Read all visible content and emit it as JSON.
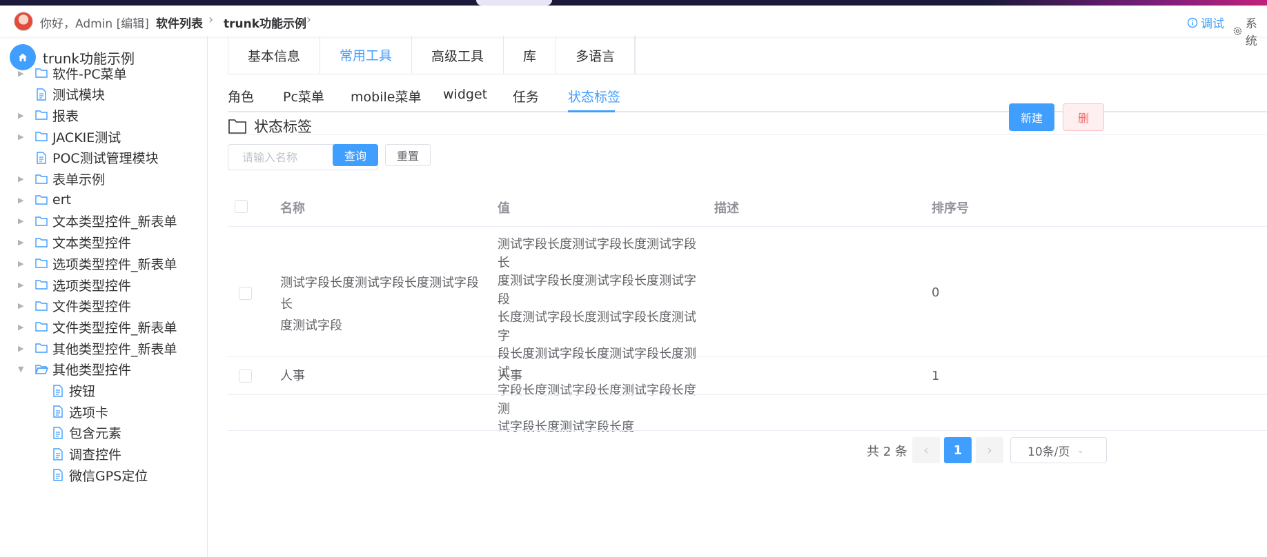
{
  "header": {
    "greeting": "你好，Admin [编辑]",
    "breadcrumb": [
      "软件列表",
      "trunk功能示例"
    ],
    "debug_label": "调试",
    "system_label": "系统"
  },
  "sidebar": {
    "root_label": "trunk功能示例",
    "items": [
      {
        "label": "软件-PC菜单",
        "type": "folder",
        "arrow": true
      },
      {
        "label": "测试模块",
        "type": "file",
        "arrow": false
      },
      {
        "label": "报表",
        "type": "folder",
        "arrow": true
      },
      {
        "label": "JACKIE测试",
        "type": "folder",
        "arrow": true
      },
      {
        "label": "POC测试管理模块",
        "type": "file",
        "arrow": false
      },
      {
        "label": "表单示例",
        "type": "folder",
        "arrow": true
      },
      {
        "label": "ert",
        "type": "folder",
        "arrow": true
      },
      {
        "label": "文本类型控件_新表单",
        "type": "folder",
        "arrow": true
      },
      {
        "label": "文本类型控件",
        "type": "folder",
        "arrow": true
      },
      {
        "label": "选项类型控件_新表单",
        "type": "folder",
        "arrow": true
      },
      {
        "label": "选项类型控件",
        "type": "folder",
        "arrow": true
      },
      {
        "label": "文件类型控件",
        "type": "folder",
        "arrow": true
      },
      {
        "label": "文件类型控件_新表单",
        "type": "folder",
        "arrow": true
      },
      {
        "label": "其他类型控件_新表单",
        "type": "folder",
        "arrow": true
      },
      {
        "label": "其他类型控件",
        "type": "folder-open",
        "arrow": true,
        "expanded": true
      },
      {
        "label": "按钮",
        "type": "file",
        "child": true
      },
      {
        "label": "选项卡",
        "type": "file",
        "child": true
      },
      {
        "label": "包含元素",
        "type": "file",
        "child": true
      },
      {
        "label": "调查控件",
        "type": "file",
        "child": true
      },
      {
        "label": "微信GPS定位",
        "type": "file",
        "child": true
      }
    ]
  },
  "tabs_primary": [
    "基本信息",
    "常用工具",
    "高级工具",
    "库",
    "多语言"
  ],
  "tabs_primary_active": 1,
  "tabs_secondary": [
    "角色",
    "Pc菜单",
    "mobile菜单",
    "widget",
    "任务",
    "状态标签"
  ],
  "tabs_secondary_active": 5,
  "section": {
    "title": "状态标签",
    "new_button": "新建",
    "delete_button": "删"
  },
  "search": {
    "placeholder": "请输入名称",
    "query_button": "查询",
    "reset_button": "重置"
  },
  "table": {
    "columns": [
      "名称",
      "值",
      "描述",
      "排序号"
    ],
    "rows": [
      {
        "name": [
          "测试字段长度测试字段长度测试字段长",
          "度测试字段"
        ],
        "value": [
          "测试字段长度测试字段长度测试字段长",
          "度测试字段长度测试字段长度测试字段",
          "长度测试字段长度测试字段长度测试字",
          "段长度测试字段长度测试字段长度测试",
          "字段长度测试字段长度测试字段长度测",
          "试字段长度测试字段长度"
        ],
        "description": "",
        "order": "0"
      },
      {
        "name": [
          "人事"
        ],
        "value": [
          "人事"
        ],
        "description": "",
        "order": "1"
      }
    ]
  },
  "pagination": {
    "total_text": "共 2 条",
    "prev": "‹",
    "current_page": "1",
    "next": "›",
    "page_size": "10条/页"
  },
  "colors": {
    "primary": "#409eff",
    "text": "#303133",
    "muted": "#909399"
  }
}
